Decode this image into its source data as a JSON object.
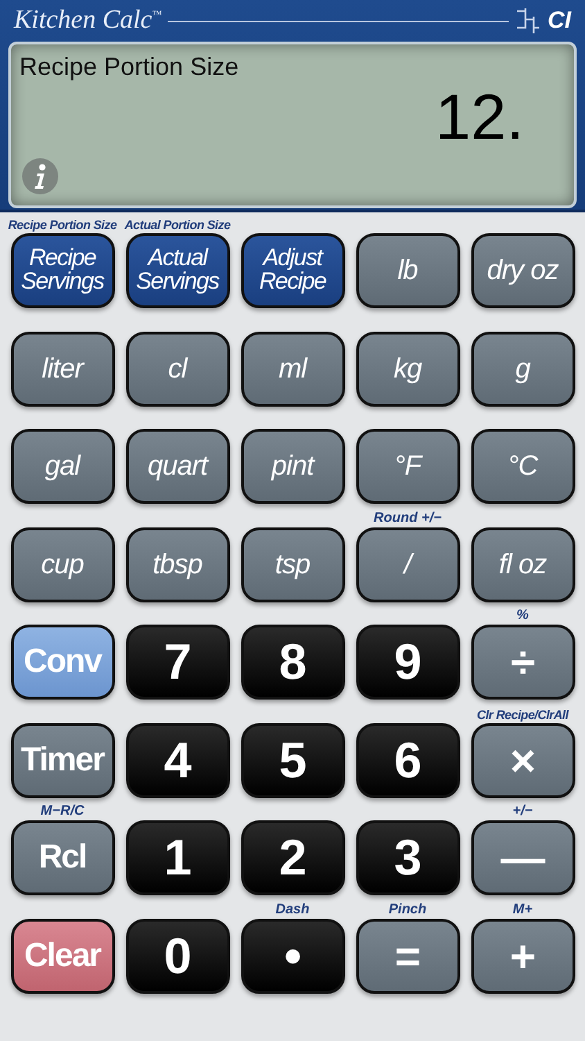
{
  "header": {
    "brand": "Kitchen Calc",
    "trademark": "™",
    "maker_logo": "CI"
  },
  "display": {
    "label": "Recipe Portion Size",
    "value": "12."
  },
  "keys": [
    {
      "kind": "blue",
      "label": "Recipe\nServings",
      "caption": "Recipe Portion Size"
    },
    {
      "kind": "blue",
      "label": "Actual\nServings",
      "caption": "Actual Portion Size"
    },
    {
      "kind": "blue",
      "label": "Adjust\nRecipe"
    },
    {
      "kind": "gray",
      "label": "lb"
    },
    {
      "kind": "gray",
      "label": "dry oz"
    },
    {
      "kind": "gray",
      "label": "liter"
    },
    {
      "kind": "gray",
      "label": "cl"
    },
    {
      "kind": "gray",
      "label": "ml"
    },
    {
      "kind": "gray",
      "label": "kg"
    },
    {
      "kind": "gray",
      "label": "g"
    },
    {
      "kind": "gray",
      "label": "gal"
    },
    {
      "kind": "gray",
      "label": "quart"
    },
    {
      "kind": "gray",
      "label": "pint"
    },
    {
      "kind": "gray",
      "label": "°F"
    },
    {
      "kind": "gray",
      "label": "°C"
    },
    {
      "kind": "gray",
      "label": "cup"
    },
    {
      "kind": "gray",
      "label": "tbsp"
    },
    {
      "kind": "gray",
      "label": "tsp"
    },
    {
      "kind": "gray",
      "label": "/",
      "caption": "Round +/−"
    },
    {
      "kind": "gray",
      "label": "fl oz"
    },
    {
      "kind": "light",
      "label": "Conv"
    },
    {
      "kind": "black",
      "label": "7"
    },
    {
      "kind": "black",
      "label": "8"
    },
    {
      "kind": "black",
      "label": "9"
    },
    {
      "kind": "op",
      "label": "÷",
      "caption": "%"
    },
    {
      "kind": "graybold",
      "label": "Timer"
    },
    {
      "kind": "black",
      "label": "4"
    },
    {
      "kind": "black",
      "label": "5"
    },
    {
      "kind": "black",
      "label": "6"
    },
    {
      "kind": "op",
      "label": "×",
      "caption": "Clr Recipe/ClrAll"
    },
    {
      "kind": "graybold",
      "label": "Rcl",
      "caption": "M−R/C"
    },
    {
      "kind": "black",
      "label": "1"
    },
    {
      "kind": "black",
      "label": "2"
    },
    {
      "kind": "black",
      "label": "3"
    },
    {
      "kind": "op",
      "label": "—",
      "caption": "+/−"
    },
    {
      "kind": "red",
      "label": "Clear"
    },
    {
      "kind": "black",
      "label": "0"
    },
    {
      "kind": "black",
      "label": "•",
      "caption": "Dash"
    },
    {
      "kind": "op",
      "label": "=",
      "caption": "Pinch"
    },
    {
      "kind": "op",
      "label": "+",
      "caption": "M+"
    }
  ]
}
